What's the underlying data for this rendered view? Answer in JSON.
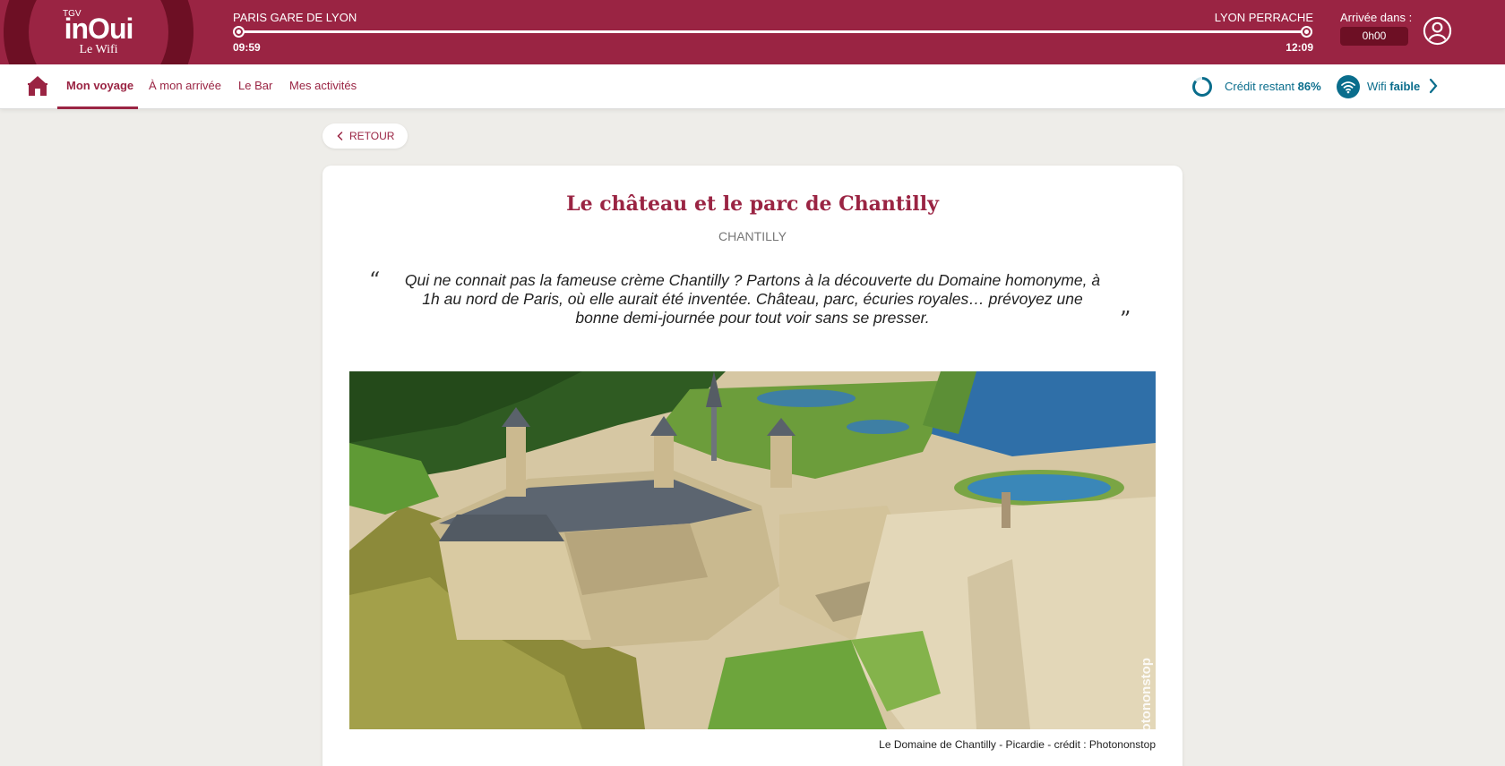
{
  "header": {
    "logo": {
      "brand_small": "TGV",
      "brand": "inOui",
      "product": "Le Wifi"
    },
    "departure": {
      "station": "PARIS GARE DE LYON",
      "time": "09:59"
    },
    "arrival": {
      "station": "LYON PERRACHE",
      "time": "12:09"
    },
    "arrival_in": {
      "label": "Arrivée dans :",
      "value": "0h00"
    },
    "journey_progress_fraction": 1.0,
    "user_icon": "user-circle-icon"
  },
  "nav": {
    "home_icon": "home-icon",
    "tabs": [
      {
        "label": "Mon voyage",
        "active": true
      },
      {
        "label": "À mon arrivée",
        "active": false
      },
      {
        "label": "Le Bar",
        "active": false
      },
      {
        "label": "Mes activités",
        "active": false
      }
    ],
    "credit": {
      "label": "Crédit restant",
      "value": "86%",
      "fraction": 0.86
    },
    "wifi": {
      "label": "Wifi",
      "level": "faible"
    }
  },
  "back_button": {
    "label": "RETOUR"
  },
  "article": {
    "title": "Le château et le parc de Chantilly",
    "location": "CHANTILLY",
    "quote_open": "“",
    "quote_close": "”",
    "quote": "Qui ne connait pas la fameuse crème Chantilly ? Partons à la découverte du Domaine homonyme, à 1h au nord de Paris, où elle aurait été inventée. Château, parc, écuries royales… prévoyez une bonne demi-journée pour tout voir sans se presser.",
    "image_watermark": "photononstop",
    "caption": "Le Domaine de Chantilly - Picardie - crédit : Photononstop"
  },
  "colors": {
    "brand": "#9a2443",
    "brand_dark": "#6d0f24",
    "accent_blue": "#0a6d8c",
    "page_background": "#eeede9"
  }
}
